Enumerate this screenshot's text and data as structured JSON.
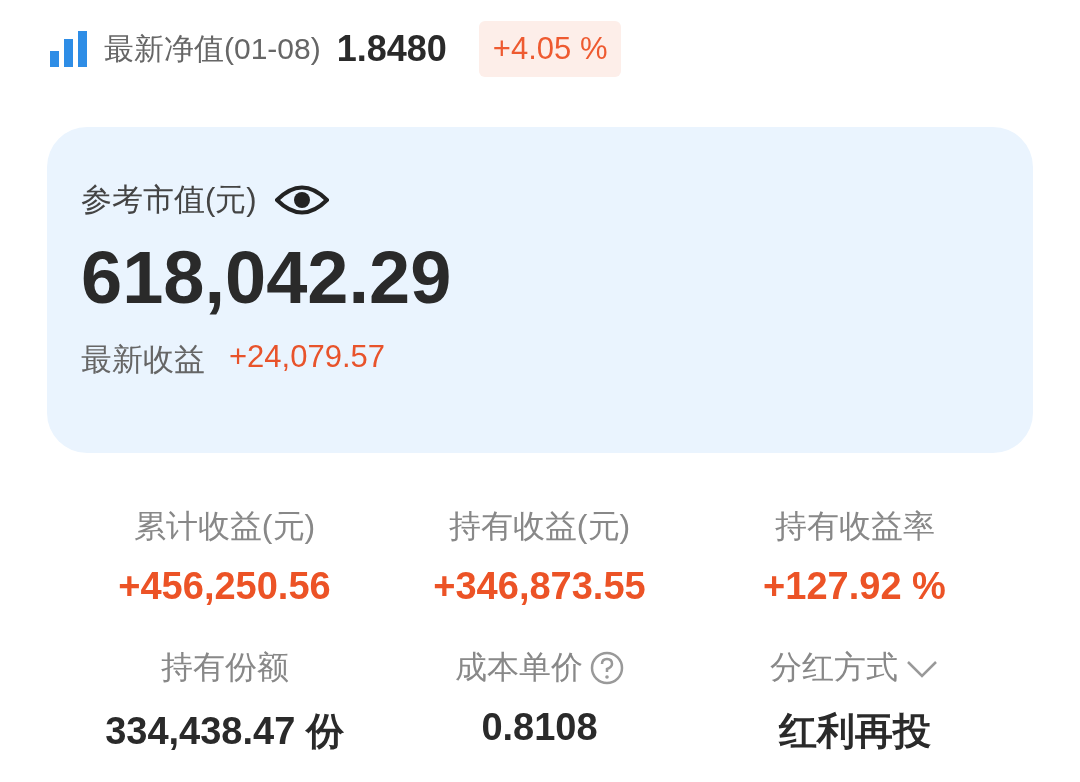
{
  "header": {
    "nav_label": "最新净值(01-08)",
    "nav_value": "1.8480",
    "change": "+4.05 %"
  },
  "market_value": {
    "label": "参考市值(元)",
    "amount": "618,042.29",
    "latest_profit_label": "最新收益",
    "latest_profit": "+24,079.57"
  },
  "stats": [
    {
      "label": "累计收益(元)",
      "value": "+456,250.56",
      "kind": "gain"
    },
    {
      "label": "持有收益(元)",
      "value": "+346,873.55",
      "kind": "gain"
    },
    {
      "label": "持有收益率",
      "value": "+127.92 %",
      "kind": "gain"
    },
    {
      "label": "持有份额",
      "value": "334,438.47 份",
      "kind": "plain"
    },
    {
      "label": "成本单价",
      "value": "0.8108",
      "kind": "help"
    },
    {
      "label": "分红方式",
      "value": "红利再投",
      "kind": "dropdown"
    }
  ]
}
